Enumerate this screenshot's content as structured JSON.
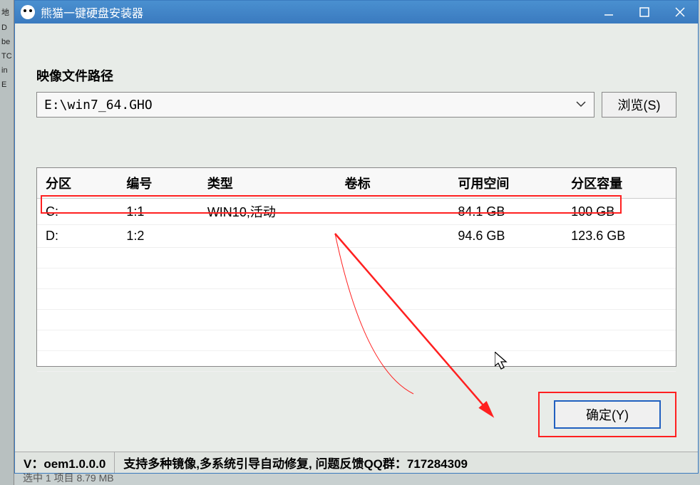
{
  "window": {
    "title": "熊猫一键硬盘安装器"
  },
  "pathSection": {
    "label": "映像文件路径",
    "value": "E:\\win7_64.GHO",
    "browseButton": "浏览(S)"
  },
  "table": {
    "headers": {
      "partition": "分区",
      "number": "编号",
      "type": "类型",
      "label": "卷标",
      "free": "可用空间",
      "size": "分区容量"
    },
    "rows": [
      {
        "partition": "C:",
        "number": "1:1",
        "type": "WIN10,活动",
        "label": "",
        "free": "84.1 GB",
        "size": "100 GB"
      },
      {
        "partition": "D:",
        "number": "1:2",
        "type": "",
        "label": "",
        "free": "94.6 GB",
        "size": "123.6 GB"
      }
    ]
  },
  "buttons": {
    "ok": "确定(Y)"
  },
  "statusbar": {
    "version": "V：oem1.0.0.0",
    "info": "支持多种镜像,多系统引导自动修复, 问题反馈QQ群：717284309"
  },
  "desktop": {
    "bottom": "选中 1 项目  8.79 MB"
  }
}
